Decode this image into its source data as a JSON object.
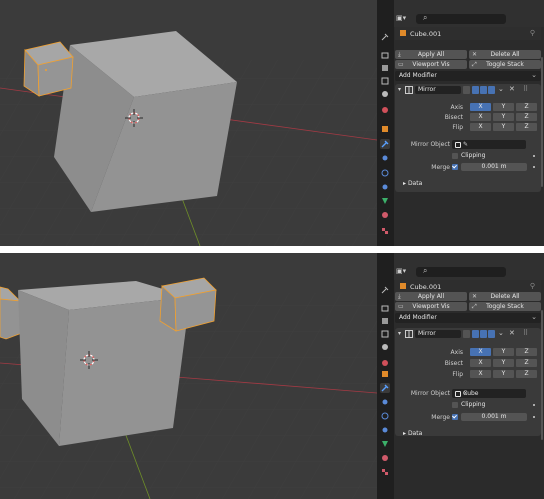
{
  "panels": [
    {
      "id": "top",
      "object_name": "Cube.001",
      "apply_all": "Apply All",
      "delete_all": "Delete All",
      "viewport_vis": "Viewport Vis",
      "toggle_stack": "Toggle Stack",
      "add_modifier": "Add Modifier",
      "modifier_name": "Mirror",
      "axis_label": "Axis",
      "bisect_label": "Bisect",
      "flip_label": "Flip",
      "x": "X",
      "y": "Y",
      "z": "Z",
      "mirror_object_label": "Mirror Object",
      "mirror_object_value": "",
      "clipping_label": "Clipping",
      "merge_label": "Merge",
      "merge_value": "0.001 m",
      "data_label": "Data"
    },
    {
      "id": "bottom",
      "object_name": "Cube.001",
      "apply_all": "Apply All",
      "delete_all": "Delete All",
      "viewport_vis": "Viewport Vis",
      "toggle_stack": "Toggle Stack",
      "add_modifier": "Add Modifier",
      "modifier_name": "Mirror",
      "axis_label": "Axis",
      "bisect_label": "Bisect",
      "flip_label": "Flip",
      "x": "X",
      "y": "Y",
      "z": "Z",
      "mirror_object_label": "Mirror Object",
      "mirror_object_value": "Cube",
      "clipping_label": "Clipping",
      "merge_label": "Merge",
      "merge_value": "0.001 m",
      "data_label": "Data"
    }
  ],
  "colors": {
    "viewport_bg": "#3b3b3b",
    "selection_outline": "#f0a030",
    "axis_x": "#c0404a",
    "axis_y": "#7a9a2a",
    "active_toggle": "#4772b3",
    "panel_bg": "#2b2b2b"
  },
  "icons": {
    "editor_type": "properties-editor-icon",
    "search": "search-icon",
    "pin": "pin-icon",
    "modifier": "wrench-icon",
    "mirror_modifier": "mirror-modifier-icon",
    "eyedropper": "eyedropper-icon"
  }
}
